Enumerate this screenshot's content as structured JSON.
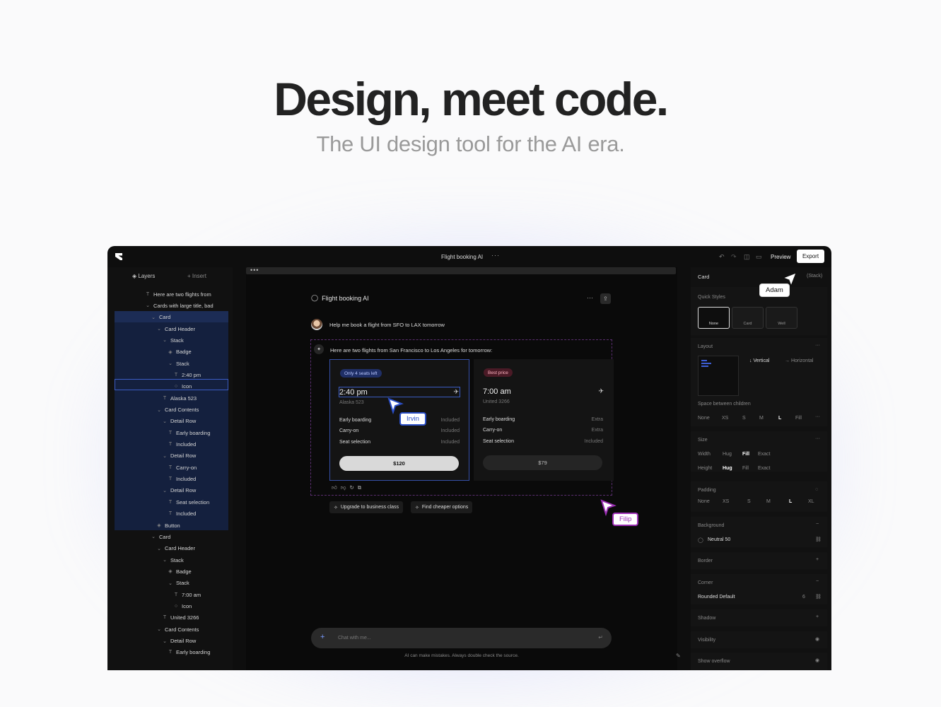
{
  "hero": {
    "title": "Design, meet code.",
    "subtitle": "The UI design tool for the AI era."
  },
  "app": {
    "doc_title": "Flight booking AI",
    "doc_more": "···",
    "preview": "Preview",
    "export": "Export"
  },
  "left": {
    "tab_layers": "Layers",
    "tab_insert": "Insert",
    "layers": [
      {
        "label": "Here are two flights from",
        "icon": "text-icon"
      },
      {
        "label": "Cards with large title, bad",
        "icon": "chevron-icon"
      },
      {
        "label": "Card",
        "icon": "chevron-icon"
      },
      {
        "label": "Card Header",
        "icon": "chevron-icon"
      },
      {
        "label": "Stack",
        "icon": "chevron-icon"
      },
      {
        "label": "Badge",
        "icon": "component-icon"
      },
      {
        "label": "Stack",
        "icon": "chevron-icon"
      },
      {
        "label": "2:40 pm",
        "icon": "text-icon"
      },
      {
        "label": "Icon",
        "icon": "circle-icon"
      },
      {
        "label": "Alaska 523",
        "icon": "text-icon"
      },
      {
        "label": "Card Contents",
        "icon": "chevron-icon"
      },
      {
        "label": "Detail Row",
        "icon": "chevron-icon"
      },
      {
        "label": "Early boarding",
        "icon": "text-icon"
      },
      {
        "label": "Included",
        "icon": "text-icon"
      },
      {
        "label": "Detail Row",
        "icon": "chevron-icon"
      },
      {
        "label": "Carry-on",
        "icon": "text-icon"
      },
      {
        "label": "Included",
        "icon": "text-icon"
      },
      {
        "label": "Detail Row",
        "icon": "chevron-icon"
      },
      {
        "label": "Seat selection",
        "icon": "text-icon"
      },
      {
        "label": "Included",
        "icon": "text-icon"
      },
      {
        "label": "Button",
        "icon": "component-icon"
      },
      {
        "label": "Card",
        "icon": "chevron-icon"
      },
      {
        "label": "Card Header",
        "icon": "chevron-icon"
      },
      {
        "label": "Stack",
        "icon": "chevron-icon"
      },
      {
        "label": "Badge",
        "icon": "component-icon"
      },
      {
        "label": "Stack",
        "icon": "chevron-icon"
      },
      {
        "label": "7:00 am",
        "icon": "text-icon"
      },
      {
        "label": "Icon",
        "icon": "circle-icon"
      },
      {
        "label": "United 3266",
        "icon": "text-icon"
      },
      {
        "label": "Card Contents",
        "icon": "chevron-icon"
      },
      {
        "label": "Detail Row",
        "icon": "chevron-icon"
      },
      {
        "label": "Early boarding",
        "icon": "text-icon"
      }
    ]
  },
  "canvas": {
    "chat_title": "Flight booking AI",
    "user_message": "Help me book a flight from SFO to LAX tomorrow",
    "ai_message": "Here are two flights from San Francisco to Los Angeles for tomorrow:",
    "cards": [
      {
        "badge": "Only 4 seats left",
        "time": "2:40 pm",
        "flight": "Alaska 523",
        "rows": [
          {
            "k": "Early boarding",
            "v": "Included"
          },
          {
            "k": "Carry-on",
            "v": "Included"
          },
          {
            "k": "Seat selection",
            "v": "Included"
          }
        ],
        "price": "$120"
      },
      {
        "badge": "Best price",
        "time": "7:00 am",
        "flight": "United 3266",
        "rows": [
          {
            "k": "Early boarding",
            "v": "Extra"
          },
          {
            "k": "Carry-on",
            "v": "Extra"
          },
          {
            "k": "Seat selection",
            "v": "Included"
          }
        ],
        "price": "$79"
      }
    ],
    "suggestions": [
      "Upgrade to business class",
      "Find cheaper options"
    ],
    "input_placeholder": "Chat with me...",
    "disclaimer": "AI can make mistakes. Always double check the source."
  },
  "cursors": {
    "adam": "Adam",
    "irvin": "Irvin",
    "filip": "Filip"
  },
  "right": {
    "element": "Card",
    "element_type": "(Stack)",
    "quick_styles_label": "Quick Styles",
    "quick_styles": [
      "None",
      "Card",
      "Well"
    ],
    "layout_label": "Layout",
    "layout_vertical": "Vertical",
    "layout_horizontal": "Horizontal",
    "space_label": "Space between children",
    "space_options": [
      "None",
      "XS",
      "S",
      "M",
      "L",
      "Fill"
    ],
    "space_selected": "L",
    "size_label": "Size",
    "width_label": "Width",
    "height_label": "Height",
    "size_options": [
      "Hug",
      "Fill",
      "Exact"
    ],
    "width_selected": "Fill",
    "height_selected": "Hug",
    "padding_label": "Padding",
    "padding_options": [
      "None",
      "XS",
      "S",
      "M",
      "L",
      "XL"
    ],
    "padding_selected": "L",
    "background_label": "Background",
    "background_value": "Neutral 50",
    "border_label": "Border",
    "corner_label": "Corner",
    "corner_value": "Rounded Default",
    "corner_number": "6",
    "shadow_label": "Shadow",
    "visibility_label": "Visibility",
    "overflow_label": "Show overflow"
  },
  "colors": {
    "accent": "#3b5cc4",
    "purple": "#9c2fb5",
    "bg": "#0e0e0e"
  }
}
